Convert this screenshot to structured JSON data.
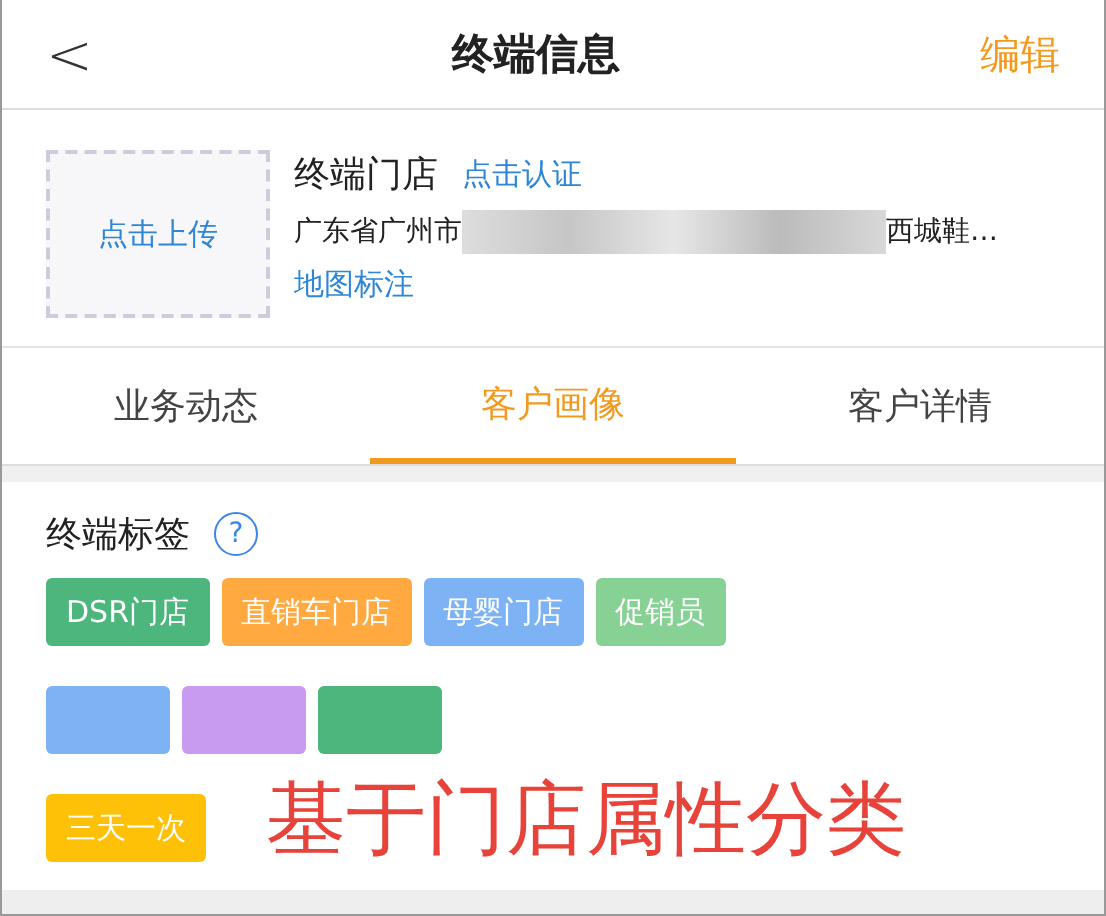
{
  "header": {
    "back": "<",
    "title": "终端信息",
    "action": "编辑"
  },
  "store": {
    "upload": "点击上传",
    "name": "终端门店",
    "verify": "点击认证",
    "address_start": "广东省广州市",
    "address_end": "西城鞋…",
    "map": "地图标注"
  },
  "tabs": [
    {
      "label": "业务动态",
      "selected": false
    },
    {
      "label": "客户画像",
      "selected": true
    },
    {
      "label": "客户详情",
      "selected": false
    }
  ],
  "tags_section": {
    "title": "终端标签",
    "help": "?",
    "tags": [
      {
        "kind": "label",
        "label": "DSR门店",
        "color": "#4cb67c"
      },
      {
        "kind": "label",
        "label": "直销车门店",
        "color": "#ffa940"
      },
      {
        "kind": "label",
        "label": "母婴门店",
        "color": "#7db3f5"
      },
      {
        "kind": "label",
        "label": "促销员",
        "color": "#86d193"
      },
      {
        "kind": "blurred",
        "color": "#7db3f5"
      },
      {
        "kind": "blurred",
        "color": "#c89af0"
      },
      {
        "kind": "blurred",
        "color": "#4cb67c"
      },
      {
        "kind": "label",
        "label": "三天一次",
        "color": "#ffc107"
      }
    ]
  },
  "annotation": "基于门店属性分类"
}
